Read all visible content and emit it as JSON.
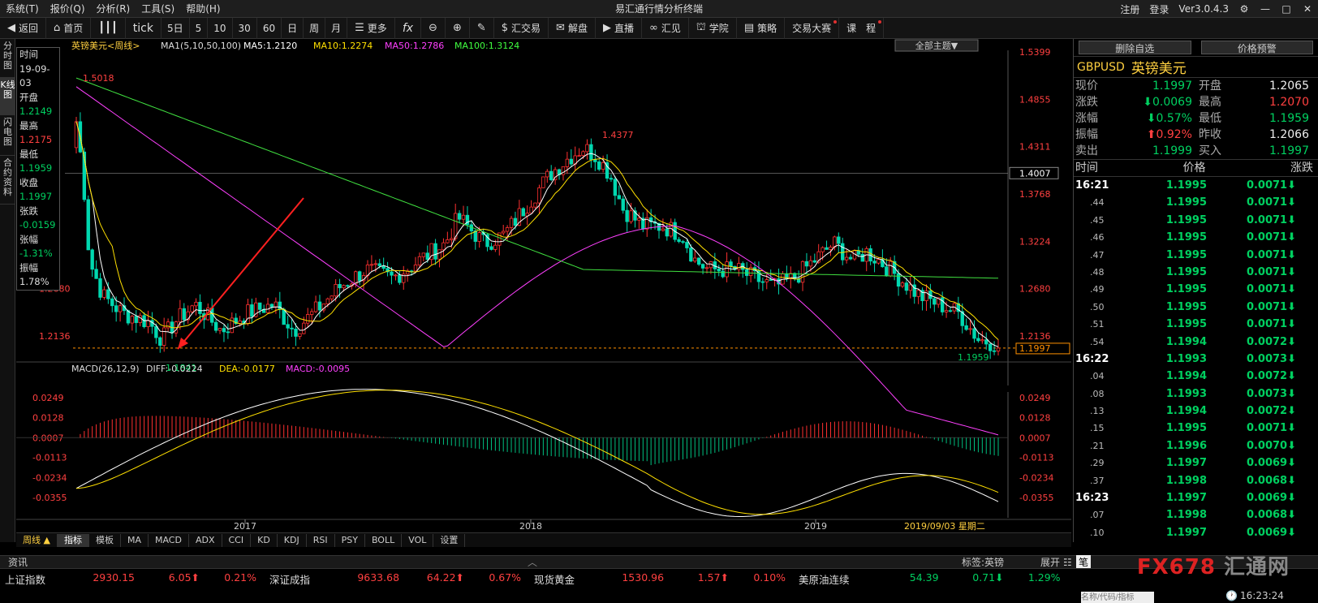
{
  "menu": {
    "items": [
      "系统(T)",
      "报价(Q)",
      "分析(R)",
      "工具(S)",
      "帮助(H)"
    ],
    "title": "易汇通行情分析终端",
    "right": [
      "注册",
      "登录",
      "Ver3.0.4.3"
    ]
  },
  "toolbar": {
    "items": [
      "返回",
      "首页",
      "",
      "tick",
      "5日",
      "5",
      "10",
      "30",
      "60",
      "日",
      "周",
      "月",
      "更多",
      "fx",
      "",
      "",
      "汇交易",
      "解盘",
      "直播",
      "汇见",
      "学院",
      "策略",
      "交易大赛",
      "课　程"
    ]
  },
  "lefttabs": [
    "分时图",
    "K线图",
    "闪电图",
    "合约资料"
  ],
  "chart": {
    "header": "英镑美元<周线>",
    "ma_label": "MA1(5,10,50,100)",
    "ma5": "MA5:1.2120",
    "ma10": "MA10:1.2274",
    "ma50": "MA50:1.2786",
    "ma100": "MA100:1.3124",
    "theme_btn": "全部主题▼",
    "price_ticks_right": [
      "1.5399",
      "1.4855",
      "1.4311",
      "1.3768",
      "1.3224",
      "1.2680",
      "1.2136"
    ],
    "price_ticks_left": [
      "1.2680",
      "1.2136"
    ],
    "crosshair_price": "1.4007",
    "current_price": "1.1997",
    "annotations": {
      "high1": "1.5018",
      "high2": "1.4377",
      "low1": "1.1841",
      "low2": "1.1959"
    },
    "macd_header": "MACD(26,12,9)",
    "diff": "DIFF:-0.0224",
    "dea": "DEA:-0.0177",
    "macd": "MACD:-0.0095",
    "macd_ticks": [
      "0.0249",
      "0.0128",
      "0.0007",
      "-0.0113",
      "-0.0234",
      "-0.0355"
    ],
    "years": [
      "2017",
      "2018",
      "2019"
    ],
    "date_label": "2019/09/03 星期二",
    "period_label": "周线 ▲"
  },
  "info": [
    {
      "l": "时间",
      "v": "19-09-03"
    },
    {
      "l": "开盘",
      "v": "1.2149",
      "c": "g"
    },
    {
      "l": "最高",
      "v": "1.2175",
      "c": "r"
    },
    {
      "l": "最低",
      "v": "1.1959",
      "c": "g"
    },
    {
      "l": "收盘",
      "v": "1.1997",
      "c": "g"
    },
    {
      "l": "张跌",
      "v": "-0.0159",
      "c": "g"
    },
    {
      "l": "张幅",
      "v": "-1.31%",
      "c": "g"
    },
    {
      "l": "振幅",
      "v": "1.78%",
      "c": "v"
    }
  ],
  "bottomtabs": [
    "指标",
    "模板",
    "MA",
    "MACD",
    "ADX",
    "CCI",
    "KD",
    "KDJ",
    "RSI",
    "PSY",
    "BOLL",
    "VOL",
    "设置"
  ],
  "right": {
    "buttons": [
      "删除自选",
      "价格预警"
    ],
    "symbol": "GBPUSD",
    "name": "英镑美元",
    "quote": [
      [
        "现价",
        "1.1997",
        "g",
        "开盘",
        "1.2065",
        "w"
      ],
      [
        "涨跌",
        "⬇0.0069",
        "g",
        "最高",
        "1.2070",
        "r"
      ],
      [
        "涨幅",
        "⬇0.57%",
        "g",
        "最低",
        "1.1959",
        "g"
      ],
      [
        "振幅",
        "⬆0.92%",
        "r",
        "昨收",
        "1.2066",
        "w"
      ],
      [
        "卖出",
        "1.1999",
        "g",
        "买入",
        "1.1997",
        "g"
      ]
    ],
    "ticks_header": [
      "时间",
      "价格",
      "涨跌"
    ],
    "ticks": [
      [
        "16:21",
        "1.1995",
        "0.0071⬇"
      ],
      [
        ".44",
        "1.1995",
        "0.0071⬇"
      ],
      [
        ".45",
        "1.1995",
        "0.0071⬇"
      ],
      [
        ".46",
        "1.1995",
        "0.0071⬇"
      ],
      [
        ".47",
        "1.1995",
        "0.0071⬇"
      ],
      [
        ".48",
        "1.1995",
        "0.0071⬇"
      ],
      [
        ".49",
        "1.1995",
        "0.0071⬇"
      ],
      [
        ".50",
        "1.1995",
        "0.0071⬇"
      ],
      [
        ".51",
        "1.1995",
        "0.0071⬇"
      ],
      [
        ".54",
        "1.1994",
        "0.0072⬇"
      ],
      [
        "16:22",
        "1.1993",
        "0.0073⬇"
      ],
      [
        ".04",
        "1.1994",
        "0.0072⬇"
      ],
      [
        ".08",
        "1.1993",
        "0.0073⬇"
      ],
      [
        ".13",
        "1.1994",
        "0.0072⬇"
      ],
      [
        ".15",
        "1.1995",
        "0.0071⬇"
      ],
      [
        ".21",
        "1.1996",
        "0.0070⬇"
      ],
      [
        ".29",
        "1.1997",
        "0.0069⬇"
      ],
      [
        ".37",
        "1.1998",
        "0.0068⬇"
      ],
      [
        "16:23",
        "1.1997",
        "0.0069⬇"
      ],
      [
        ".07",
        "1.1998",
        "0.0068⬇"
      ],
      [
        ".10",
        "1.1997",
        "0.0069⬇"
      ]
    ]
  },
  "status": {
    "left": "资讯",
    "tag": "标签:英镑",
    "expand": "展开",
    "hl": "笔"
  },
  "ticker": [
    [
      "上证指数",
      "2930.15",
      "6.05⬆",
      "0.21%"
    ],
    [
      "深证成指",
      "9633.68",
      "64.22⬆",
      "0.67%"
    ],
    [
      "现货黄金",
      "1530.96",
      "1.57⬆",
      "0.10%"
    ],
    [
      "美原油连续",
      "54.39",
      "0.71⬇",
      "1.29%"
    ]
  ],
  "search_placeholder": "名称/代码/指标",
  "clock": "16:23:24",
  "logo": "FX678 汇通网"
}
